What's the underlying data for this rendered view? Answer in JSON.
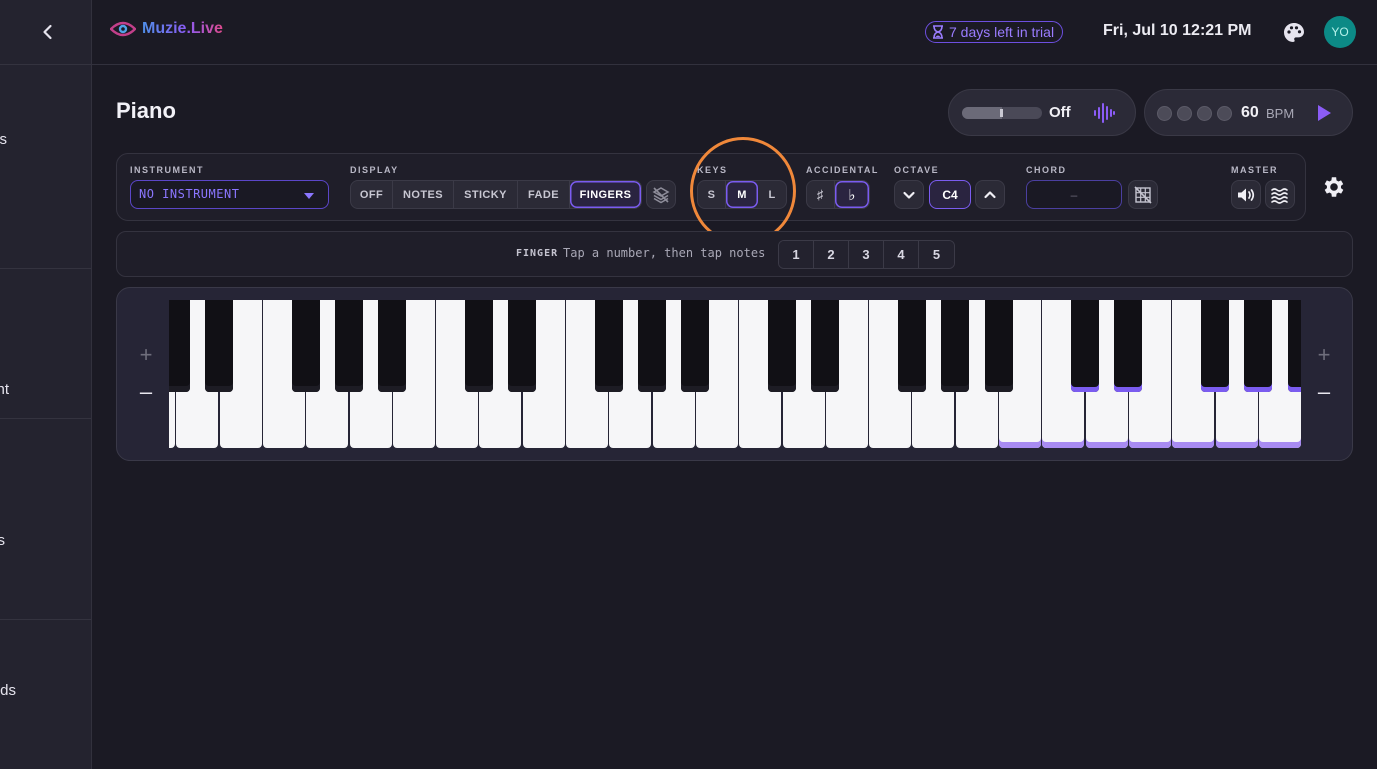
{
  "sidebar": {
    "items": [
      {
        "label": "s"
      },
      {
        "label": "nt"
      },
      {
        "label": "s"
      },
      {
        "label": "ds"
      }
    ]
  },
  "header": {
    "brand": "Muzie.Live",
    "trial_badge": "7 days left in trial",
    "datetime": "Fri, Jul 10 12:21 PM",
    "avatar_initials": "YO"
  },
  "page": {
    "title": "Piano"
  },
  "metronome": {
    "volume_state": "Off",
    "volume_level": 0.5,
    "bpm": "60",
    "bpm_unit": "BPM",
    "beats": 4
  },
  "toolbar": {
    "instrument": {
      "label": "INSTRUMENT",
      "value": "NO INSTRUMENT"
    },
    "display": {
      "label": "DISPLAY",
      "options": [
        "OFF",
        "NOTES",
        "STICKY",
        "FADE",
        "FINGERS"
      ],
      "active": "FINGERS"
    },
    "keys": {
      "label": "KEYS",
      "options": [
        "S",
        "M",
        "L"
      ],
      "active": "M"
    },
    "accidental": {
      "label": "ACCIDENTAL",
      "sharp": "♯",
      "flat": "♭",
      "active": "flat"
    },
    "octave": {
      "label": "OCTAVE",
      "value": "C4"
    },
    "chord": {
      "label": "CHORD",
      "value": "–"
    },
    "master": {
      "label": "MASTER"
    }
  },
  "finger": {
    "label": "FINGER",
    "hint": "Tap a number, then tap notes",
    "options": [
      "1",
      "2",
      "3",
      "4",
      "5"
    ]
  },
  "keyboard": {
    "zoom_in": "+",
    "zoom_out": "–",
    "highlighted_from_white_index": 20
  },
  "colors": {
    "accent": "#7b5cf0",
    "highlight_ring": "#f0883a",
    "avatar": "#0c8a86"
  }
}
